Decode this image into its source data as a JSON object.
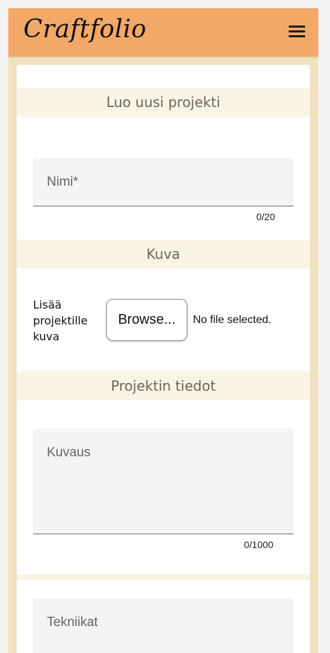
{
  "app": {
    "title": "Craftfolio"
  },
  "header": {
    "menu_icon": "hamburger-menu-icon"
  },
  "form": {
    "section_create": "Luo uusi projekti",
    "name_field": {
      "label": "Nimi*",
      "counter": "0/20"
    },
    "section_image": "Kuva",
    "image_upload": {
      "label": "Lisää projektille kuva",
      "button": "Browse...",
      "status": "No file selected."
    },
    "section_details": "Projektin tiedot",
    "description_field": {
      "label": "Kuvaus",
      "counter": "0/1000"
    },
    "techniques_field": {
      "label": "Tekniikat"
    }
  },
  "colors": {
    "appbar": "#f2a867",
    "background": "#f2e3bf",
    "section_band": "#faf4e6",
    "field_fill": "#f4f4f4"
  }
}
